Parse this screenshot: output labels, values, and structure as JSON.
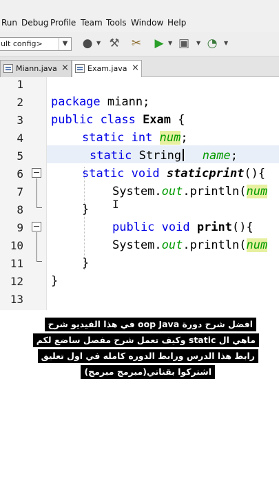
{
  "menu": [
    "Run",
    "Debug",
    "Profile",
    "Team",
    "Tools",
    "Window",
    "Help"
  ],
  "toolbar": {
    "config_value": "ult config>",
    "icons": [
      "globe-icon",
      "hammer-icon",
      "clean-build-icon",
      "run-icon",
      "debug-icon",
      "profile-icon"
    ]
  },
  "tabs": [
    {
      "label": "Miann.java",
      "close": "×",
      "active": false
    },
    {
      "label": "Exam.java",
      "close": "×",
      "active": true
    }
  ],
  "editor": {
    "line_numbers": [
      "1",
      "2",
      "3",
      "4",
      "5",
      "6",
      "7",
      "8",
      "9",
      "10",
      "11",
      "12",
      "13"
    ],
    "code": {
      "l2_kw": "package",
      "l2_rest": " miann;",
      "l3_kw": "public class",
      "l3_name": " Exam",
      "l3_rest": " {",
      "l4_kw": "static int",
      "l4_field": "num",
      "l4_rest": ";",
      "l5_kw": "static",
      "l5_type": " String",
      "l5_field": "name",
      "l5_rest": ";",
      "l6_kw": "static void",
      "l6_method": " staticprint",
      "l6_rest": "(){",
      "l7_obj": "System.",
      "l7_out": "out",
      "l7_call": ".println(",
      "l7_arg": "num",
      "l8_brace": "}",
      "l9_kw": "public void",
      "l9_method": " print",
      "l9_rest": "(){",
      "l10_obj": "System.",
      "l10_out": "out",
      "l10_call": ".println(",
      "l10_arg": "num",
      "l11_brace": "}",
      "l12_brace": "}"
    }
  },
  "caption": {
    "lines": [
      "افضل شرح دورة oop Java في هذا الفيديو شرح",
      "ماهي ال static وكيف تعمل شرح مفصل ساضع لكم",
      "رابط هذا الدرس ورابط الدوره كامله في اول تعليق",
      "اشتركوا بقناتي(مبرمج مبرمج)"
    ]
  },
  "colors": {
    "keyword": "#0000e6",
    "field": "#009b00",
    "highlight": "#e7f0a0",
    "current_line": "#e9eff8"
  }
}
